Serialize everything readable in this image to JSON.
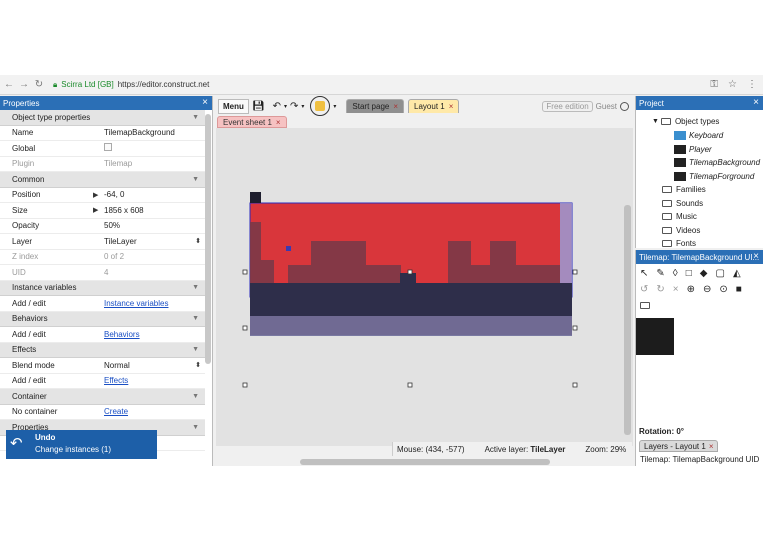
{
  "browser": {
    "secure_label": "Scirra Ltd [GB]",
    "url": "https://editor.construct.net"
  },
  "properties": {
    "title": "Properties",
    "sections": [
      {
        "label": "Object type properties",
        "rows": [
          {
            "key": "Name",
            "value": "TilemapBackground"
          },
          {
            "key": "Global",
            "value": ""
          },
          {
            "key": "Plugin",
            "value": "Tilemap"
          }
        ]
      },
      {
        "label": "Common",
        "rows": [
          {
            "key": "Position",
            "value": "-64, 0"
          },
          {
            "key": "Size",
            "value": "1856 x 608"
          },
          {
            "key": "Opacity",
            "value": "50%"
          },
          {
            "key": "Layer",
            "value": "TileLayer"
          },
          {
            "key": "Z index",
            "value": "0 of 2"
          },
          {
            "key": "UID",
            "value": "4"
          }
        ]
      },
      {
        "label": "Instance variables",
        "rows": [
          {
            "key": "Add / edit",
            "value": "Instance variables"
          }
        ]
      },
      {
        "label": "Behaviors",
        "rows": [
          {
            "key": "Add / edit",
            "value": "Behaviors"
          }
        ]
      },
      {
        "label": "Effects",
        "rows": [
          {
            "key": "Blend mode",
            "value": "Normal"
          },
          {
            "key": "Add / edit",
            "value": "Effects"
          }
        ]
      },
      {
        "label": "Container",
        "rows": [
          {
            "key": "No container",
            "value": "Create"
          }
        ]
      },
      {
        "label": "Properties",
        "rows": []
      }
    ]
  },
  "toast": {
    "title": "Undo",
    "subtitle": "Change instances (1)"
  },
  "toolbar": {
    "menu_label": "Menu",
    "tabs": [
      "Start page",
      "Layout 1"
    ],
    "free_edition": "Free edition",
    "guest": "Guest"
  },
  "event_tab": "Event sheet 1",
  "status": {
    "mouse": "Mouse: (434, -577)",
    "active_layer_label": "Active layer:",
    "active_layer_value": "TileLayer",
    "zoom": "Zoom: 29%"
  },
  "project": {
    "title": "Project",
    "object_types_label": "Object types",
    "object_types": [
      "Keyboard",
      "Player",
      "TilemapBackground",
      "TilemapForground"
    ],
    "folders": [
      "Families",
      "Sounds",
      "Music",
      "Videos",
      "Fonts"
    ]
  },
  "tilemap": {
    "title": "Tilemap: TilemapBackground UI...",
    "rotation": "Rotation: 0°",
    "layers_tab": "Layers - Layout 1",
    "uid_line": "Tilemap: TilemapBackground UID"
  },
  "colors": {
    "accent": "#2b6fb6",
    "tile_red": "#d9363b",
    "tile_dark": "#3a3a5a"
  }
}
